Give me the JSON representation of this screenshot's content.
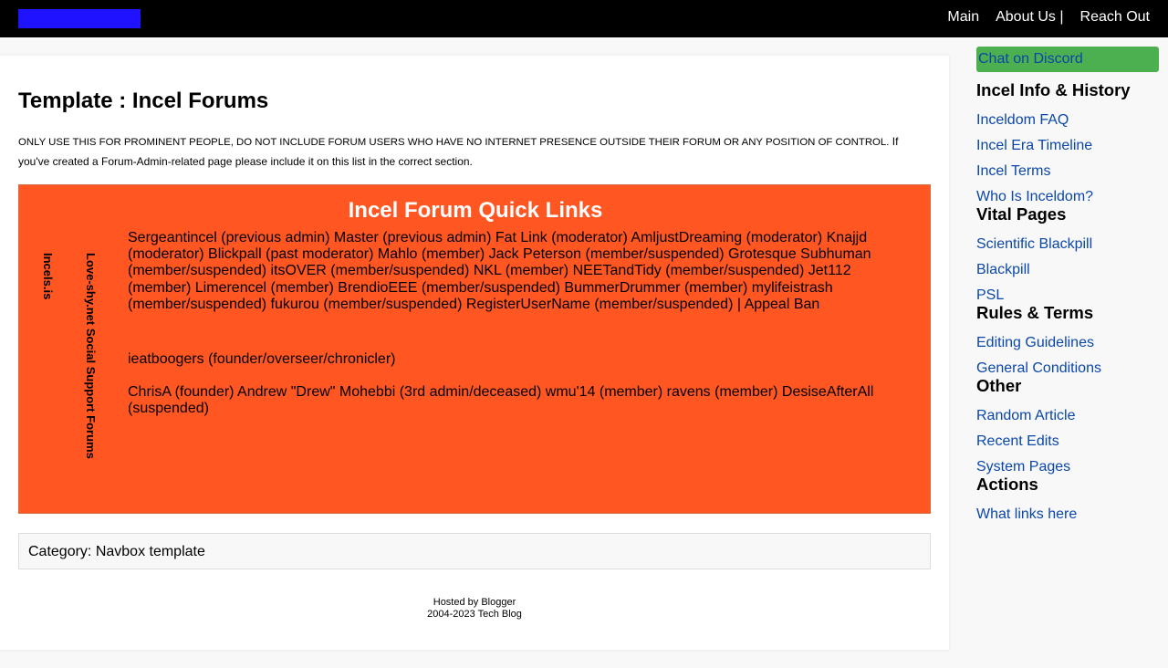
{
  "colors": {
    "topbar": "#000000",
    "logo": "#1f12ff",
    "navbox_bg": "#ff5622",
    "discord_btn": "#4caf50",
    "link": "#0b47a8"
  },
  "topnav": {
    "items": [
      "Main",
      "About Us |",
      "Reach Out"
    ]
  },
  "page": {
    "title": "Template : Incel Forums",
    "notice_caps": "ONLY USE THIS FOR PROMINENT PEOPLE, DO NOT INCLUDE FORUM USERS WHO HAVE NO INTERNET PRESENCE OUTSIDE THEIR FORUM OR ANY POSITION OF CONTROL.",
    "notice_rest": "If you've created a Forum-Admin-related page please include it on this list in the correct section."
  },
  "navbox": {
    "title": "Incel Forum Quick Links",
    "labels": [
      "Incels.is",
      "Love-shy.net Social Support Forums"
    ],
    "groups": [
      "Sergeantincel (previous admin) Master (previous admin) Fat Link (moderator) AmljustDreaming (moderator) Knajjd (moderator) Blickpall (past moderator) Mahlo (member) Jack Peterson (member/suspended) Grotesque Subhuman (member/suspended) itsOVER (member/suspended) NKL (member) NEETandTidy (member/suspended) Jet112 (member) Limerencel (member) BrendioEEE (member/suspended) BummerDrummer (member) mylifeistrash (member/suspended) fukurou (member/suspended) RegisterUserName (member/suspended) | Appeal Ban",
      "ieatboogers (founder/overseer/chronicler)",
      "ChrisA (founder) Andrew \"Drew\" Mohebbi (3rd admin/deceased) wmu'14 (member) ravens (member) DesiseAfterAll (suspended)"
    ]
  },
  "category": "Category: Navbox template",
  "footer": {
    "line1": "Hosted by Blogger",
    "line2": "2004-2023 Tech Blog"
  },
  "sidebar": {
    "discord": "Chat on Discord",
    "sections": [
      {
        "heading": "Incel Info & History",
        "links": [
          "Inceldom FAQ",
          "Incel Era Timeline",
          "Incel Terms",
          "Who Is Inceldom?"
        ]
      },
      {
        "heading": "Vital Pages",
        "links": [
          "Scientific Blackpill",
          "Blackpill",
          "PSL"
        ]
      },
      {
        "heading": "Rules & Terms",
        "links": [
          "Editing Guidelines",
          "General Conditions"
        ]
      },
      {
        "heading": "Other",
        "links": [
          "Random Article",
          "Recent Edits",
          "System Pages"
        ]
      },
      {
        "heading": "Actions",
        "links": [
          "What links here"
        ]
      }
    ]
  }
}
